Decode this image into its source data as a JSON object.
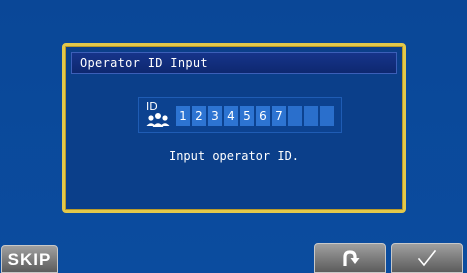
{
  "dialog": {
    "title": "Operator ID Input",
    "prompt": "Input operator ID."
  },
  "id_input": {
    "icon_label": "ID",
    "icon": "operators-icon",
    "digits": [
      "1",
      "2",
      "3",
      "4",
      "5",
      "6",
      "7",
      "",
      "",
      ""
    ]
  },
  "buttons": {
    "skip_label": "SKIP",
    "back_icon": "return-arrow-icon",
    "ok_icon": "checkmark-icon"
  },
  "colors": {
    "background": "#0b4a9c",
    "dialog_border": "#e3c84a",
    "digit_cell": "#2a6fcc",
    "button": "#8a8a8a"
  }
}
